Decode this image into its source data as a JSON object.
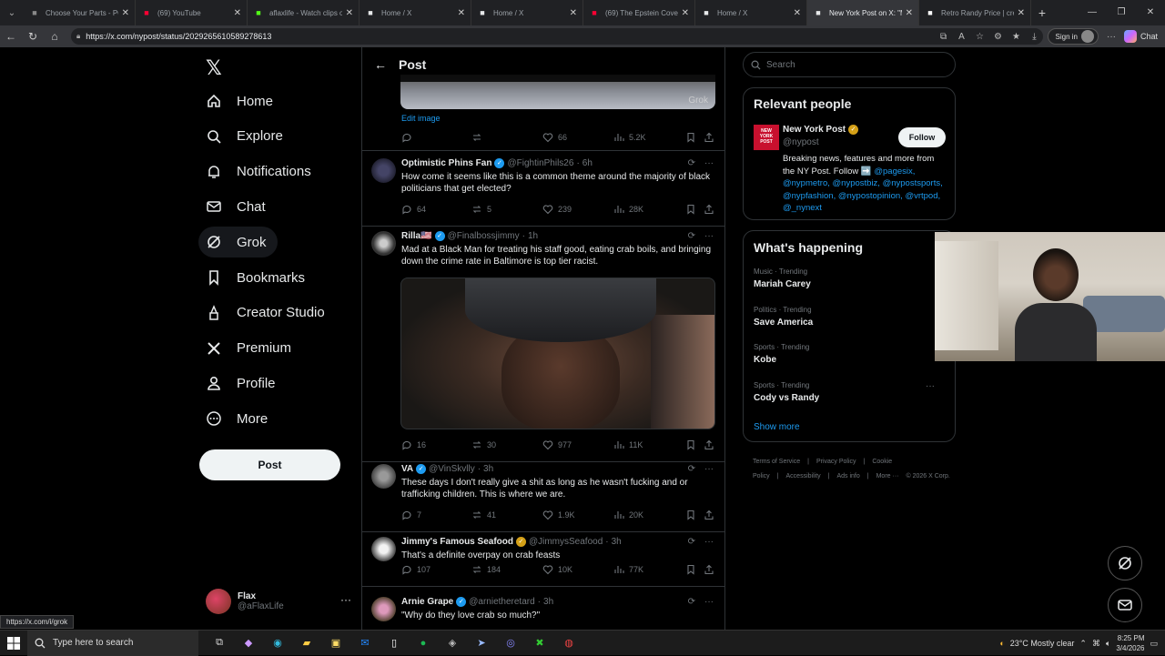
{
  "browser": {
    "tabs": [
      {
        "title": "Choose Your Parts - PC",
        "icon": "pcpartpicker-icon",
        "color": "#888888"
      },
      {
        "title": "(69) YouTube",
        "icon": "youtube-icon",
        "color": "#ff0033"
      },
      {
        "title": "aflaxlife - Watch clips o",
        "icon": "kick-icon",
        "color": "#53fc18"
      },
      {
        "title": "Home / X",
        "icon": "x-icon",
        "color": "#e7e9ea"
      },
      {
        "title": "Home / X",
        "icon": "x-icon",
        "color": "#e7e9ea"
      },
      {
        "title": "(69) The Epstein Covera",
        "icon": "youtube-icon",
        "color": "#ff0033"
      },
      {
        "title": "Home / X",
        "icon": "x-icon",
        "color": "#e7e9ea"
      },
      {
        "title": "New York Post on X: \"M",
        "icon": "x-icon",
        "color": "#e7e9ea",
        "active": true
      },
      {
        "title": "Retro Randy Price | crea",
        "icon": "pricecharting-icon",
        "color": "#ffffff"
      }
    ],
    "url": "https://x.com/nypost/status/2029265610589278613",
    "signin_label": "Sign in",
    "chat_label": "Chat"
  },
  "sidebar": {
    "nav": [
      {
        "label": "Home",
        "icon": "home-icon"
      },
      {
        "label": "Explore",
        "icon": "search-icon"
      },
      {
        "label": "Notifications",
        "icon": "bell-icon"
      },
      {
        "label": "Chat",
        "icon": "mail-icon"
      },
      {
        "label": "Grok",
        "icon": "grok-icon"
      },
      {
        "label": "Bookmarks",
        "icon": "bookmark-icon"
      },
      {
        "label": "Creator Studio",
        "icon": "creator-icon"
      },
      {
        "label": "Premium",
        "icon": "x-premium-icon"
      },
      {
        "label": "Profile",
        "icon": "person-icon"
      },
      {
        "label": "More",
        "icon": "more-circle-icon"
      }
    ],
    "post_label": "Post",
    "account": {
      "name": "Flax",
      "handle": "@aFlaxLife"
    },
    "status_link": "https://x.com/i/grok"
  },
  "main": {
    "title": "Post",
    "image_watermark": "Grok",
    "edit_image_label": "Edit image",
    "top_actions": {
      "replies": "",
      "reposts": "",
      "likes": "66",
      "views": "5.2K"
    },
    "replies": [
      {
        "name": "Optimistic Phins Fan",
        "handle": "@FightinPhils26",
        "time": "6h",
        "badge": "blue",
        "text": "How come it seems like this is a common theme around the majority of black politicians that get elected?",
        "replies": "64",
        "reposts": "5",
        "likes": "239",
        "views": "28K"
      },
      {
        "name": "Rilla🇺🇸",
        "handle": "@Finalbossjimmy",
        "time": "1h",
        "badge": "blue",
        "text": "Mad at a Black Man for treating his staff good, eating crab boils, and bringing down the crime rate in Baltimore is top tier racist.",
        "replies": "16",
        "reposts": "30",
        "likes": "977",
        "views": "11K"
      },
      {
        "name": "VA",
        "handle": "@VinSkvlly",
        "time": "3h",
        "badge": "blue",
        "text": "These days I don't really give a shit as long as he wasn't fucking and or trafficking children. This is where we are.",
        "replies": "7",
        "reposts": "41",
        "likes": "1.9K",
        "views": "20K"
      },
      {
        "name": "Jimmy's Famous Seafood",
        "handle": "@JimmysSeafood",
        "time": "3h",
        "badge": "gold",
        "text": "That's a definite overpay on crab feasts",
        "replies": "107",
        "reposts": "184",
        "likes": "10K",
        "views": "77K"
      },
      {
        "name": "Arnie Grape",
        "handle": "@arnietheretard",
        "time": "3h",
        "badge": "blue",
        "text": "\"Why do they love crab so much?\""
      }
    ]
  },
  "right": {
    "search_placeholder": "Search",
    "relevant_title": "Relevant people",
    "nypost": {
      "name": "New York Post",
      "handle": "@nypost",
      "follow_label": "Follow",
      "logo_text": "NEW YORK POST",
      "bio_plain": "Breaking news, features and more from the NY Post. Follow ➡️ ",
      "bio_links": [
        "@pagesix,",
        "@nypmetro,",
        "@nypostbiz,",
        "@nypostsports,",
        "@nypfashion,",
        "@nypostopinion,",
        "@vrtpod,",
        "@_nynext"
      ]
    },
    "happening_title": "What's happening",
    "trends": [
      {
        "category": "Music · Trending",
        "name": "Mariah Carey"
      },
      {
        "category": "Politics · Trending",
        "name": "Save America"
      },
      {
        "category": "Sports · Trending",
        "name": "Kobe"
      },
      {
        "category": "Sports · Trending",
        "name": "Cody vs Randy"
      }
    ],
    "show_more": "Show more",
    "footer": [
      "Terms of Service",
      "|",
      "Privacy Policy",
      "|",
      "Cookie Policy",
      "|",
      "Accessibility",
      "|",
      "Ads info",
      "|",
      "More ···",
      "© 2026 X Corp."
    ]
  },
  "taskbar": {
    "search_placeholder": "Type here to search",
    "weather": "23°C  Mostly clear",
    "time": "8:25 PM",
    "date": "3/4/2026"
  }
}
